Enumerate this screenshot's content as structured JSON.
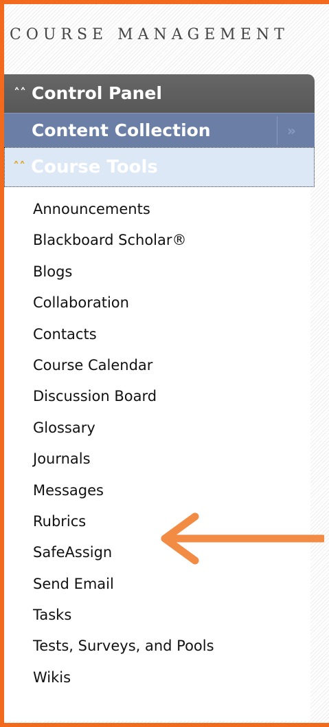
{
  "header": {
    "title": "COURSE MANAGEMENT"
  },
  "control_panel": {
    "label": "Control Panel",
    "collapse_icon": "double-chevron-up-icon"
  },
  "content_collection": {
    "label": "Content Collection",
    "expand_icon": "double-chevron-right-icon"
  },
  "course_tools": {
    "label": "Course Tools",
    "collapse_icon": "double-chevron-up-icon",
    "items": [
      "Announcements",
      "Blackboard Scholar®",
      "Blogs",
      "Collaboration",
      "Contacts",
      "Course Calendar",
      "Discussion Board",
      "Glossary",
      "Journals",
      "Messages",
      "Rubrics",
      "SafeAssign",
      "Send Email",
      "Tasks",
      "Tests, Surveys, and Pools",
      "Wikis"
    ]
  },
  "annotation": {
    "arrow_target": "Rubrics",
    "arrow_color": "#f28c45"
  },
  "colors": {
    "frame_border": "#f26a1b",
    "control_panel_bg": "#5e5e5e",
    "content_collection_bg": "#6a7ea6",
    "course_tools_bg": "#dde8f7",
    "chevron_gold": "#d9a51e"
  }
}
